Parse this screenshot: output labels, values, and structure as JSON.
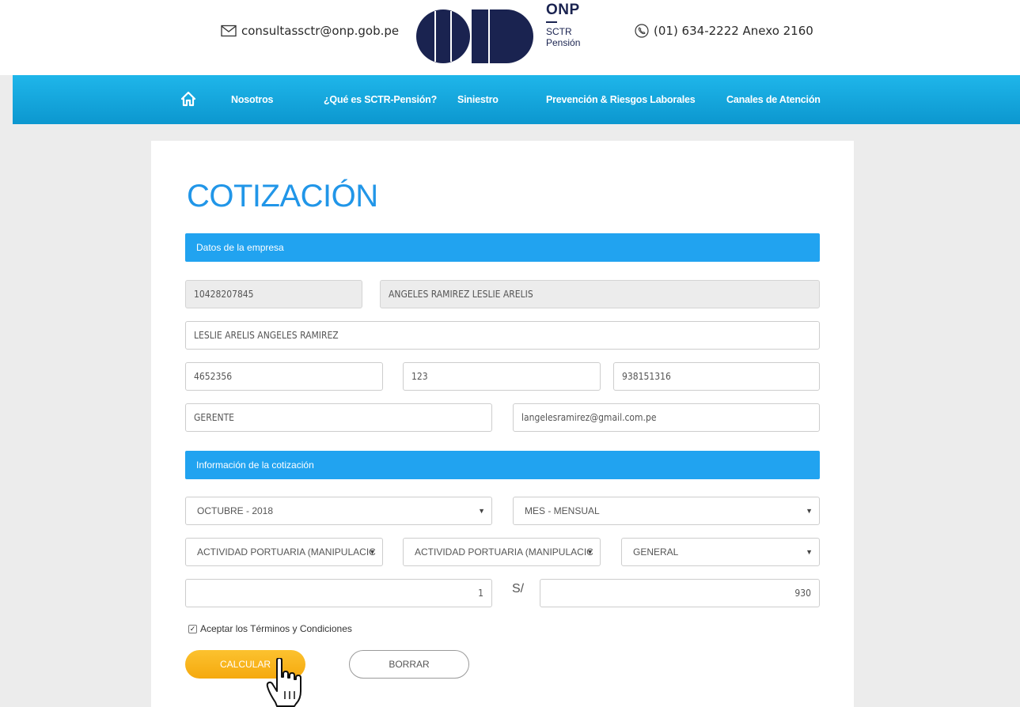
{
  "header": {
    "email": "consultassctr@onp.gob.pe",
    "phone": "(01) 634-2222 Anexo 2160",
    "logo": {
      "onp": "ONP",
      "sctr": "SCTR",
      "pension": "Pensión"
    }
  },
  "nav": {
    "items": [
      "Nosotros",
      "¿Qué es SCTR-Pensión?",
      "Siniestro",
      "Prevención & Riesgos Laborales",
      "Canales de Atención"
    ]
  },
  "form": {
    "title": "COTIZACIÓN",
    "section_company": "Datos de la empresa",
    "ruc": "10428207845",
    "razon_social": "ANGELES RAMIREZ LESLIE ARELIS",
    "contact_name": "LESLIE ARELIS ANGELES RAMIREZ",
    "phone": "4652356",
    "annex": "123",
    "mobile": "938151316",
    "position": "GERENTE",
    "email": "langelesramirez@gmail.com.pe",
    "section_quote": "Información de la cotización",
    "period": "OCTUBRE - 2018",
    "frequency": "MES - MENSUAL",
    "activity_1": "ACTIVIDAD PORTUARIA (MANIPULACIC",
    "activity_2": "ACTIVIDAD PORTUARIA (MANIPULACIC",
    "category": "GENERAL",
    "workers": "1",
    "currency": "S/",
    "amount": "930",
    "terms_label": "Aceptar los Términos y Condiciones",
    "terms_checked": "✓",
    "calc_label": "CALCULAR",
    "clear_label": "BORRAR"
  },
  "colors": {
    "nav": "#0c97cf",
    "title": "#2196e8",
    "section_bar": "#21a3f0",
    "calc_button": "#f5a90e",
    "logo": "#1a2350"
  }
}
